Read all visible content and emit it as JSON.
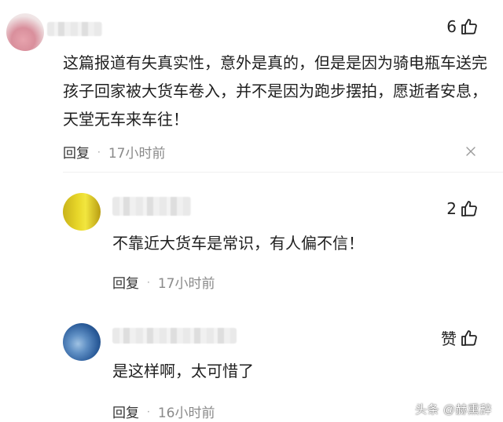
{
  "comments": [
    {
      "likes": "6",
      "text": "这篇报道有失真实性，意外是真的，但是是因为骑电瓶车送完孩子回家被大货车卷入，并不是因为跑步摆拍，愿逝者安息，天堂无车来车往！",
      "reply_label": "回复",
      "time": "17小时前"
    },
    {
      "likes": "2",
      "text": "不靠近大货车是常识，有人偏不信！",
      "reply_label": "回复",
      "time": "17小时前"
    },
    {
      "likes": "赞",
      "text": "是这样啊，太可惜了",
      "reply_label": "回复",
      "time": "16小时前"
    }
  ],
  "meta_separator": "·",
  "watermark": "头条 @赫熏辞",
  "icons": {
    "like": "thumbs-up-icon",
    "close": "close-icon"
  }
}
